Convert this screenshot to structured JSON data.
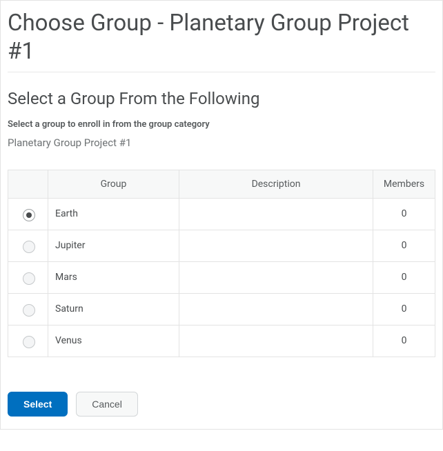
{
  "header": {
    "title": "Choose Group - Planetary Group Project #1"
  },
  "section": {
    "title": "Select a Group From the Following",
    "helper": "Select a group to enroll in from the group category",
    "category_name": "Planetary Group Project #1"
  },
  "table": {
    "columns": {
      "group": "Group",
      "description": "Description",
      "members": "Members"
    },
    "rows": [
      {
        "name": "Earth",
        "description": "",
        "members": 0,
        "selected": true
      },
      {
        "name": "Jupiter",
        "description": "",
        "members": 0,
        "selected": false
      },
      {
        "name": "Mars",
        "description": "",
        "members": 0,
        "selected": false
      },
      {
        "name": "Saturn",
        "description": "",
        "members": 0,
        "selected": false
      },
      {
        "name": "Venus",
        "description": "",
        "members": 0,
        "selected": false
      }
    ]
  },
  "actions": {
    "select": "Select",
    "cancel": "Cancel"
  }
}
